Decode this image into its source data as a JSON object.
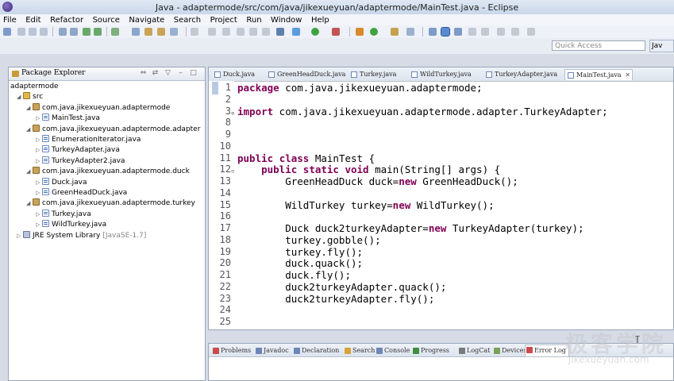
{
  "window": {
    "title": "Java - adaptermode/src/com/java/jikexueyuan/adaptermode/MainTest.java - Eclipse"
  },
  "menu": [
    "File",
    "Edit",
    "Refactor",
    "Source",
    "Navigate",
    "Search",
    "Project",
    "Run",
    "Window",
    "Help"
  ],
  "quick_access": {
    "placeholder": "Quick Access"
  },
  "perspective": {
    "label": "Jav"
  },
  "package_explorer": {
    "title": "Package Explorer",
    "tree": [
      {
        "label": "adaptermode",
        "icon": "project-icon",
        "depth": 0
      },
      {
        "label": "src",
        "icon": "source-folder-icon",
        "depth": 1
      },
      {
        "label": "com.java.jikexueyuan.adaptermode",
        "icon": "package-icon",
        "depth": 2
      },
      {
        "label": "MainTest.java",
        "icon": "java-file-icon",
        "depth": 3
      },
      {
        "label": "com.java.jikexueyuan.adaptermode.adapter",
        "icon": "package-icon",
        "depth": 2
      },
      {
        "label": "EnumerationIterator.java",
        "icon": "java-file-icon",
        "depth": 3
      },
      {
        "label": "TurkeyAdapter.java",
        "icon": "java-file-icon",
        "depth": 3
      },
      {
        "label": "TurkeyAdapter2.java",
        "icon": "java-file-icon",
        "depth": 3
      },
      {
        "label": "com.java.jikexueyuan.adaptermode.duck",
        "icon": "package-icon",
        "depth": 2
      },
      {
        "label": "Duck.java",
        "icon": "java-file-icon",
        "depth": 3
      },
      {
        "label": "GreenHeadDuck.java",
        "icon": "java-file-icon",
        "depth": 3
      },
      {
        "label": "com.java.jikexueyuan.adaptermode.turkey",
        "icon": "package-icon",
        "depth": 2
      },
      {
        "label": "Turkey.java",
        "icon": "java-file-icon",
        "depth": 3
      },
      {
        "label": "WildTurkey.java",
        "icon": "java-file-icon",
        "depth": 3
      },
      {
        "label": "JRE System Library",
        "suffix": "[JavaSE-1.7]",
        "icon": "library-icon",
        "depth": 1
      }
    ]
  },
  "editor_tabs": [
    "Duck.java",
    "GreenHeadDuck.java",
    "Turkey.java",
    "WildTurkey.java",
    "TurkeyAdapter.java",
    "MainTest.java"
  ],
  "active_tab": "MainTest.java",
  "code": [
    {
      "ln": "1",
      "text": "package com.java.jikexueyuan.adaptermode;"
    },
    {
      "ln": "2",
      "text": ""
    },
    {
      "ln": "3",
      "text": "import com.java.jikexueyuan.adaptermode.adapter.TurkeyAdapter;"
    },
    {
      "ln": "8",
      "text": ""
    },
    {
      "ln": "9",
      "text": ""
    },
    {
      "ln": "10",
      "text": ""
    },
    {
      "ln": "11",
      "text": "public class MainTest {"
    },
    {
      "ln": "12",
      "text": "    public static void main(String[] args) {"
    },
    {
      "ln": "13",
      "text": "        GreenHeadDuck duck=new GreenHeadDuck();"
    },
    {
      "ln": "14",
      "text": ""
    },
    {
      "ln": "15",
      "text": "        WildTurkey turkey=new WildTurkey();"
    },
    {
      "ln": "16",
      "text": ""
    },
    {
      "ln": "17",
      "text": "        Duck duck2turkeyAdapter=new TurkeyAdapter(turkey);"
    },
    {
      "ln": "18",
      "text": "        turkey.gobble();"
    },
    {
      "ln": "19",
      "text": "        turkey.fly();"
    },
    {
      "ln": "20",
      "text": "        duck.quack();"
    },
    {
      "ln": "21",
      "text": "        duck.fly();"
    },
    {
      "ln": "22",
      "text": "        duck2turkeyAdapter.quack();"
    },
    {
      "ln": "23",
      "text": "        duck2turkeyAdapter.fly();"
    },
    {
      "ln": "24",
      "text": ""
    },
    {
      "ln": "25",
      "text": ""
    }
  ],
  "bottom_tabs": [
    "Problems",
    "Javadoc",
    "Declaration",
    "Search",
    "Console",
    "Progress",
    "LogCat",
    "Devices",
    "Error Log"
  ],
  "active_bottom_tab": "Error Log",
  "watermark": {
    "text": "极客学院",
    "url": "jikexueyuan.com"
  },
  "colors": {
    "keyword": "#7f0055",
    "selection": "#b9c9e4"
  }
}
